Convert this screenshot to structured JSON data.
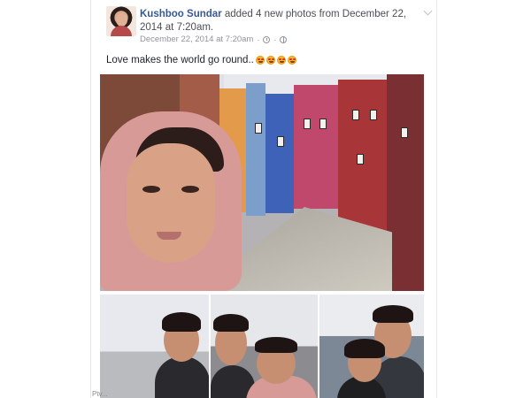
{
  "post": {
    "author": "Kushboo Sundar",
    "action_text": " added 4 new photos from December 22, 2014 at 7:20am.",
    "timestamp": "December 22, 2014 at 7:20am",
    "separator": "·",
    "status_text": "Love makes the world go round..",
    "emoji_count": 4
  },
  "photos": {
    "count": 4
  },
  "watermark": "Ptv..."
}
